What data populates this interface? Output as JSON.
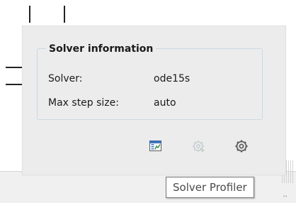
{
  "panel": {
    "group_title": "Solver information",
    "rows": [
      {
        "label": "Solver:",
        "value": "ode15s"
      },
      {
        "label": "Max step size:",
        "value": "auto"
      }
    ]
  },
  "toolbar": {
    "icons": [
      "solver-report-icon",
      "solver-reset-gear-icon-disabled",
      "settings-gear-icon"
    ]
  },
  "tooltip": {
    "text": "Solver Profiler"
  },
  "colors": {
    "panel_background": "#ececec",
    "group_border": "#c9d9e6",
    "icon_blue": "#3a78c9",
    "icon_gray": "#8a8a8a"
  }
}
